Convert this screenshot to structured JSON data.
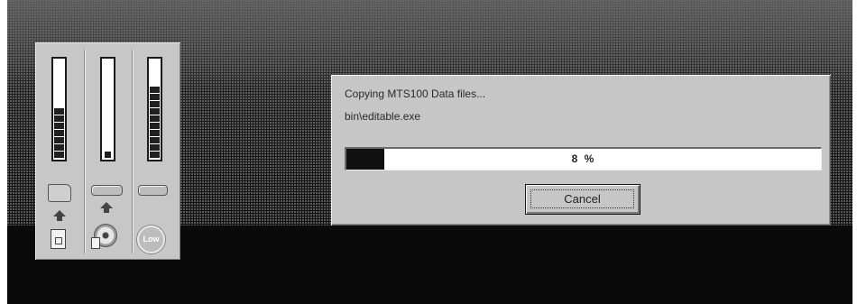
{
  "dialog": {
    "status_text": "Copying MTS100 Data files...",
    "current_file": "bin\\editable.exe",
    "progress_percent": 8,
    "progress_label": "8 %",
    "cancel_label": "Cancel"
  },
  "gauges": [
    {
      "name": "destination-disk",
      "filled_segments": 7,
      "total_segments": 7,
      "fill_fraction": 0.55
    },
    {
      "name": "source-disk",
      "fill_fraction": 0.08
    },
    {
      "name": "memory",
      "filled_segments": 9,
      "total_segments": 9,
      "fill_fraction": 0.75
    }
  ],
  "low_badge_label": "Low",
  "colors": {
    "dialog_bg": "#c6c6c6",
    "progress_fill": "#111111",
    "screen_bg": "#0a0a0a"
  }
}
